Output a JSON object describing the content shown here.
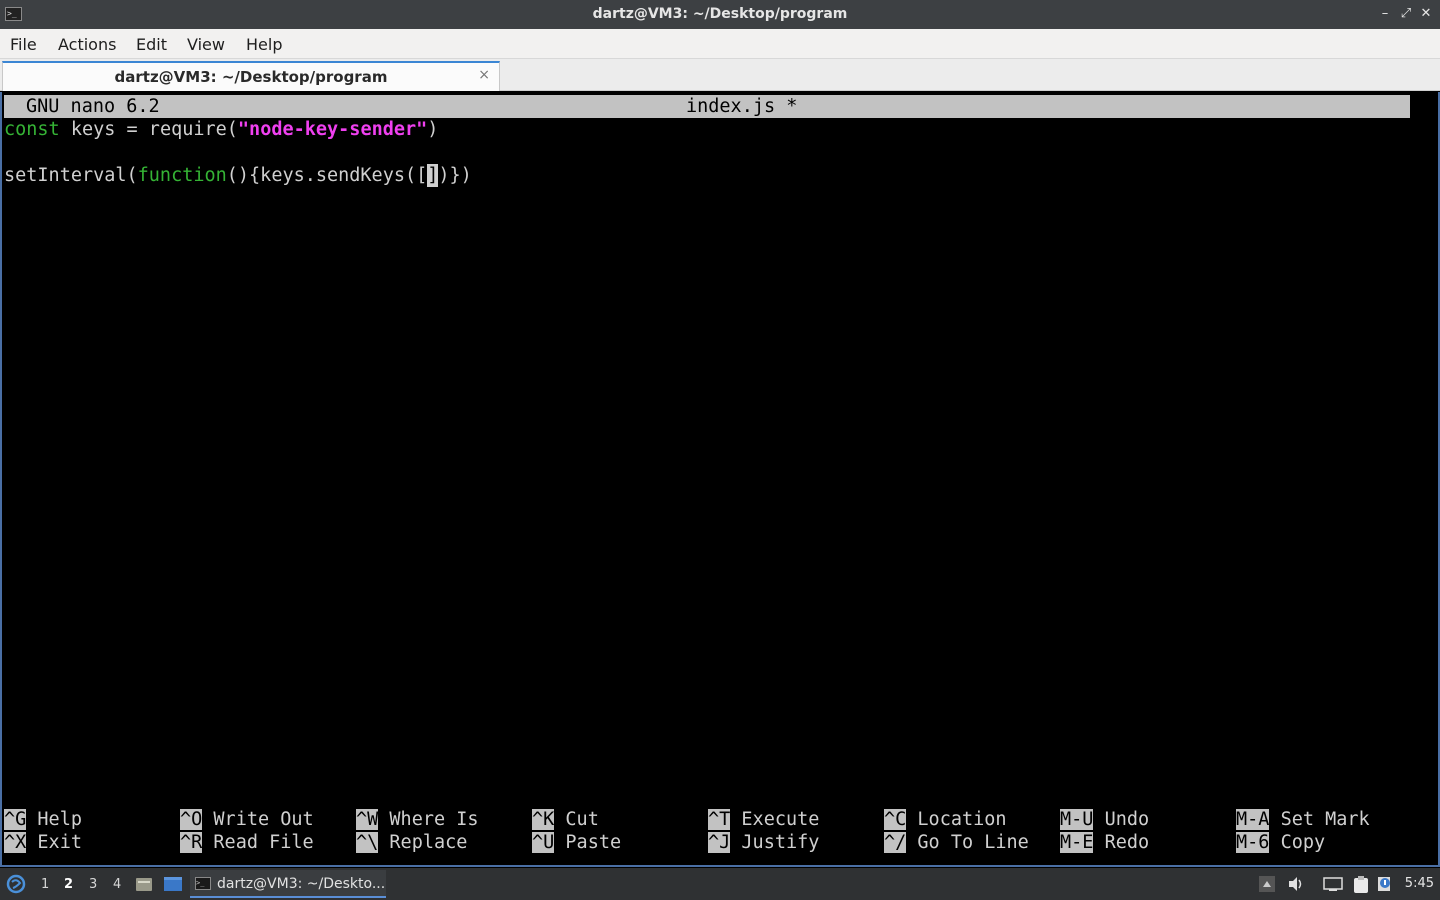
{
  "window": {
    "title": "dartz@VM3: ~/Desktop/program",
    "controls": {
      "minimize": "–",
      "maximize": "⤢",
      "close": "✕"
    }
  },
  "menubar": {
    "items": [
      "File",
      "Actions",
      "Edit",
      "View",
      "Help"
    ]
  },
  "tabs": [
    {
      "label": "dartz@VM3: ~/Desktop/program",
      "close": "×"
    }
  ],
  "nano": {
    "version": "GNU nano 6.2",
    "filename": "index.js *",
    "code": {
      "line1": {
        "keyword": "const",
        "text1": " keys = require(",
        "string": "\"node-key-sender\"",
        "text2": ")"
      },
      "line3": {
        "text1": "setInterval(",
        "keyword": "function",
        "text2": "(){keys.sendKeys([",
        "cursor_char": "]",
        "text3": ")})"
      }
    },
    "shortcuts_row1": [
      {
        "key": "^G",
        "label": "Help"
      },
      {
        "key": "^O",
        "label": "Write Out"
      },
      {
        "key": "^W",
        "label": "Where Is"
      },
      {
        "key": "^K",
        "label": "Cut"
      },
      {
        "key": "^T",
        "label": "Execute"
      },
      {
        "key": "^C",
        "label": "Location"
      },
      {
        "key": "M-U",
        "label": "Undo"
      },
      {
        "key": "M-A",
        "label": "Set Mark"
      }
    ],
    "shortcuts_row2": [
      {
        "key": "^X",
        "label": "Exit"
      },
      {
        "key": "^R",
        "label": "Read File"
      },
      {
        "key": "^\\",
        "label": "Replace"
      },
      {
        "key": "^U",
        "label": "Paste"
      },
      {
        "key": "^J",
        "label": "Justify"
      },
      {
        "key": "^/",
        "label": "Go To Line"
      },
      {
        "key": "M-E",
        "label": "Redo"
      },
      {
        "key": "M-6",
        "label": "Copy"
      }
    ]
  },
  "taskbar": {
    "desktops": [
      "1",
      "2",
      "3",
      "4"
    ],
    "active_desktop": "2",
    "task_label": "dartz@VM3: ~/Deskto...",
    "clock": "5:45"
  },
  "colors": {
    "keyword": "#35b335",
    "string": "#f040f0",
    "accent": "#3b86d4"
  }
}
